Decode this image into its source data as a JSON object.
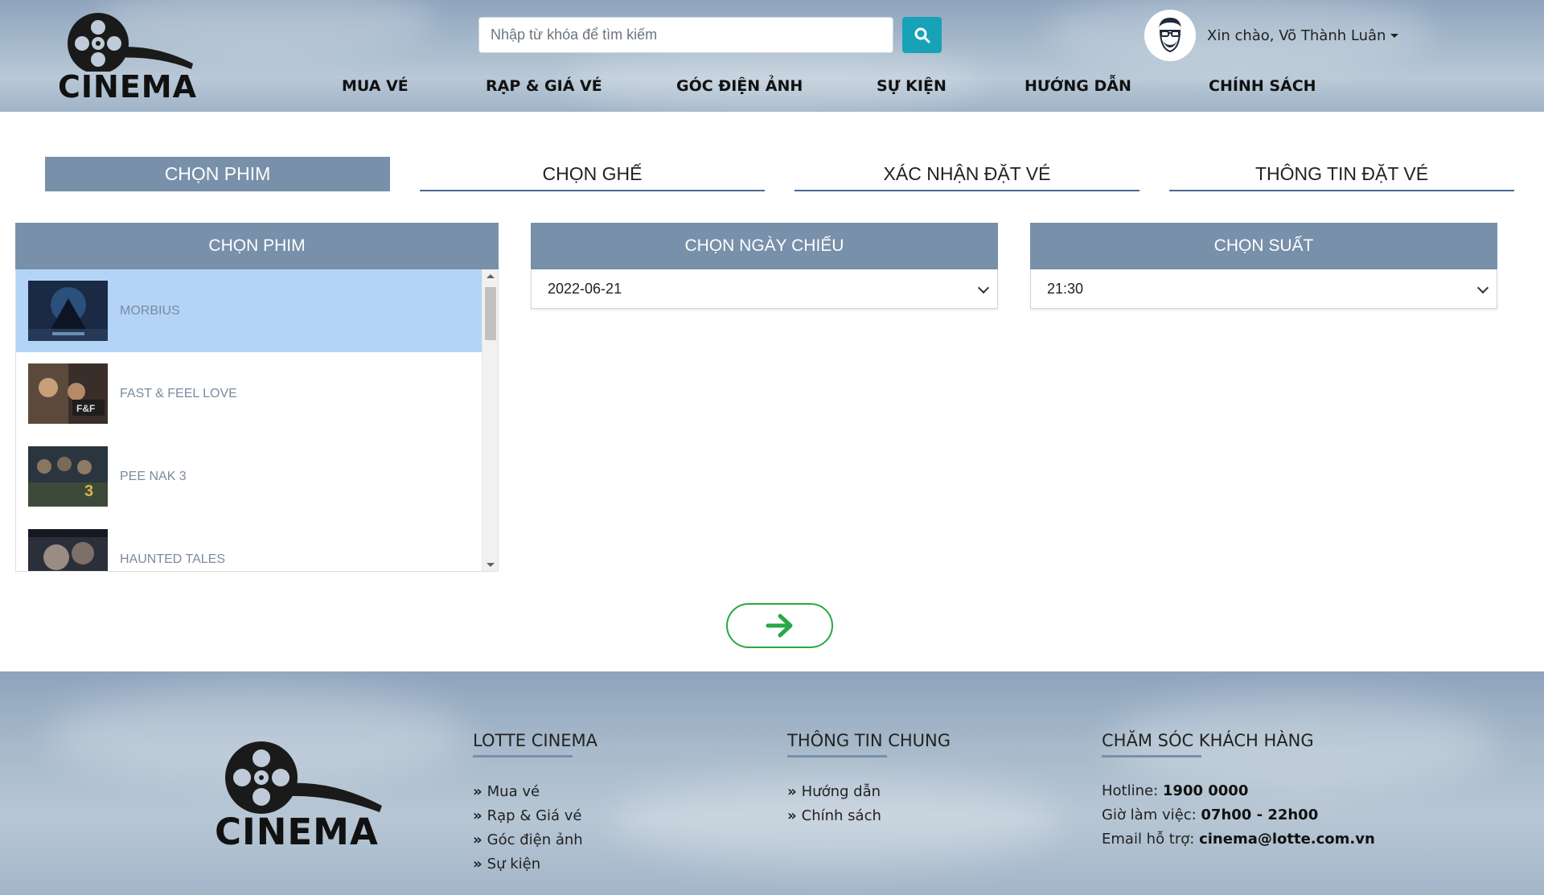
{
  "header": {
    "logo_text": "CINEMA",
    "search": {
      "placeholder": "Nhập từ khóa để tìm kiếm",
      "value": ""
    },
    "user": {
      "greeting": "Xin chào, Võ Thành Luân"
    },
    "nav": [
      "MUA VÉ",
      "RẠP & GIÁ VÉ",
      "GÓC ĐIỆN ẢNH",
      "SỰ KIỆN",
      "HƯỚNG DẪN",
      "CHÍNH SÁCH"
    ]
  },
  "steps": [
    {
      "label": "CHỌN PHIM",
      "active": true
    },
    {
      "label": "CHỌN GHẾ",
      "active": false
    },
    {
      "label": "XÁC NHẬN ĐẶT VÉ",
      "active": false
    },
    {
      "label": "THÔNG TIN ĐẶT VÉ",
      "active": false
    }
  ],
  "movie_panel": {
    "title": "CHỌN PHIM",
    "movies": [
      {
        "title": "MORBIUS",
        "selected": true
      },
      {
        "title": "FAST & FEEL LOVE",
        "selected": false
      },
      {
        "title": "PEE NAK 3",
        "selected": false
      },
      {
        "title": "HAUNTED TALES",
        "selected": false
      }
    ]
  },
  "date_panel": {
    "title": "CHỌN NGÀY CHIẾU",
    "selected": "2022-06-21"
  },
  "time_panel": {
    "title": "CHỌN SUẤT",
    "selected": "21:30"
  },
  "colors": {
    "accent": "#7890a9",
    "selected_row": "#b3d4f7",
    "search_button": "#17a2b8",
    "next_arrow": "#28a745"
  },
  "footer": {
    "logo_text": "CINEMA",
    "col1": {
      "heading": "LOTTE CINEMA",
      "links": [
        "Mua vé",
        "Rạp & Giá vé",
        "Góc điện ảnh",
        "Sự kiện"
      ]
    },
    "col2": {
      "heading": "THÔNG TIN CHUNG",
      "links": [
        "Hướng dẫn",
        "Chính sách"
      ]
    },
    "col3": {
      "heading": "CHĂM SÓC KHÁCH HÀNG",
      "hotline_label": "Hotline:",
      "hotline": "1900 0000",
      "hours_label": "Giờ làm việc:",
      "hours": "07h00 - 22h00",
      "email_label": "Email hỗ trợ:",
      "email": "cinema@lotte.com.vn"
    }
  }
}
